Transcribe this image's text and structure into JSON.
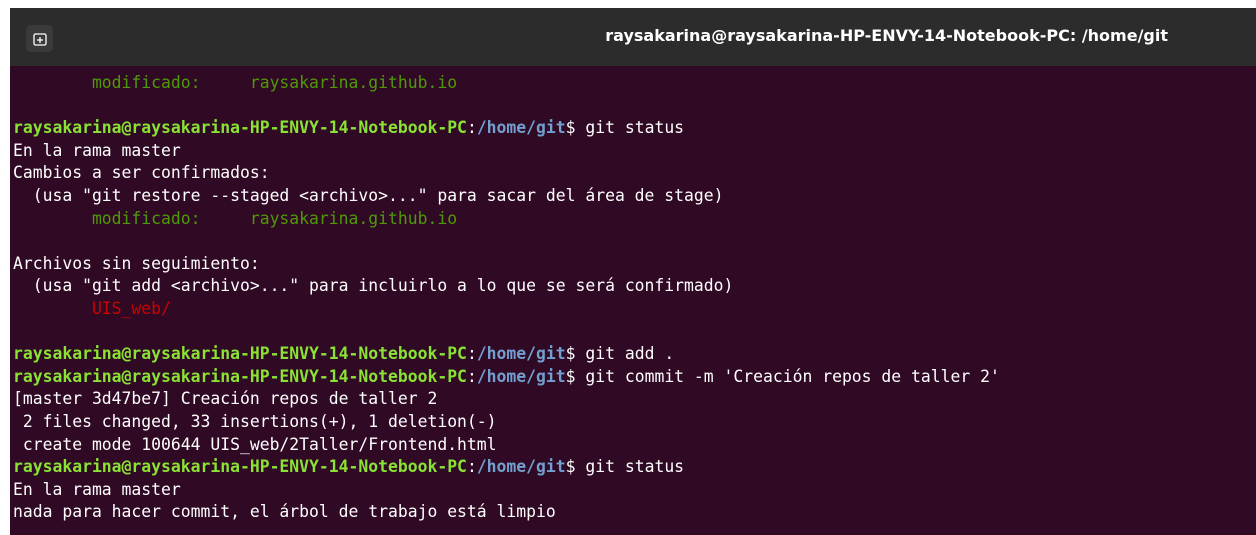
{
  "window": {
    "title": "raysakarina@raysakarina-HP-ENVY-14-Notebook-PC: /home/git",
    "new_tab_icon": "new-tab-icon"
  },
  "colors": {
    "background": "#300a24",
    "prompt_user": "#8ae234",
    "prompt_path": "#729fcf",
    "staged": "#4e9a06",
    "untracked": "#cc0000",
    "text": "#ffffff"
  },
  "terminal": {
    "prompt": {
      "user_host": "raysakarina@raysakarina-HP-ENVY-14-Notebook-PC",
      "colon": ":",
      "path": "/home/git",
      "symbol": "$ "
    },
    "lines": [
      {
        "type": "staged",
        "text": "        modificado:     raysakarina.github.io"
      },
      {
        "type": "blank",
        "text": ""
      },
      {
        "type": "prompt",
        "cmd": "git status"
      },
      {
        "type": "output",
        "text": "En la rama master"
      },
      {
        "type": "output",
        "text": "Cambios a ser confirmados:"
      },
      {
        "type": "output",
        "text": "  (usa \"git restore --staged <archivo>...\" para sacar del área de stage)"
      },
      {
        "type": "staged",
        "text": "        modificado:     raysakarina.github.io"
      },
      {
        "type": "blank",
        "text": ""
      },
      {
        "type": "output",
        "text": "Archivos sin seguimiento:"
      },
      {
        "type": "output",
        "text": "  (usa \"git add <archivo>...\" para incluirlo a lo que se será confirmado)"
      },
      {
        "type": "untracked",
        "text": "        UIS_web/"
      },
      {
        "type": "blank",
        "text": ""
      },
      {
        "type": "prompt",
        "cmd": "git add ."
      },
      {
        "type": "prompt",
        "cmd": "git commit -m 'Creación repos de taller 2'"
      },
      {
        "type": "output",
        "text": "[master 3d47be7] Creación repos de taller 2"
      },
      {
        "type": "output",
        "text": " 2 files changed, 33 insertions(+), 1 deletion(-)"
      },
      {
        "type": "output",
        "text": " create mode 100644 UIS_web/2Taller/Frontend.html"
      },
      {
        "type": "prompt",
        "cmd": "git status"
      },
      {
        "type": "output",
        "text": "En la rama master"
      },
      {
        "type": "output",
        "text": "nada para hacer commit, el árbol de trabajo está limpio"
      }
    ]
  }
}
